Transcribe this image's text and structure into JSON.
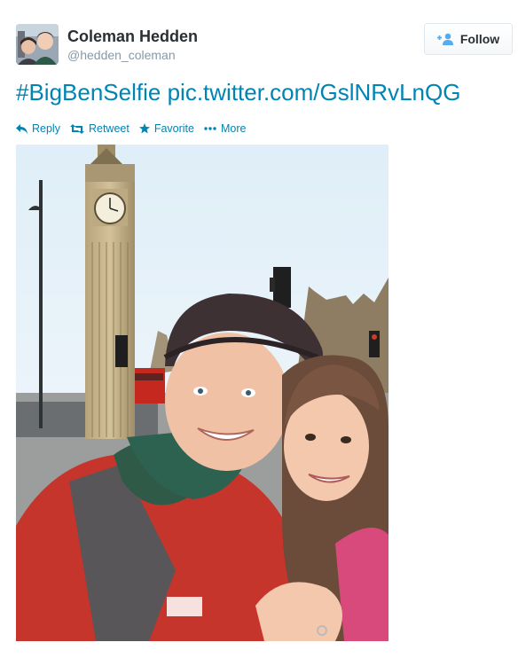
{
  "user": {
    "fullname": "Coleman Hedden",
    "username": "@hedden_coleman",
    "avatar_icon": "profile-photo"
  },
  "follow": {
    "label": "Follow",
    "icon": "add-user-icon"
  },
  "tweet": {
    "hashtag": "#BigBenSelfie",
    "link": "pic.twitter.com/GslNRvLnQG"
  },
  "actions": [
    {
      "label": "Reply",
      "icon": "reply-icon"
    },
    {
      "label": "Retweet",
      "icon": "retweet-icon"
    },
    {
      "label": "Favorite",
      "icon": "star-icon"
    },
    {
      "label": "More",
      "icon": "more-dots-icon"
    }
  ],
  "photo": {
    "subject": "selfie-in-front-of-big-ben",
    "clock_tower": "Big Ben"
  },
  "colors": {
    "link": "#0084b4",
    "text": "#292f33",
    "muted": "#8899a6",
    "follow_icon": "#55acee"
  }
}
